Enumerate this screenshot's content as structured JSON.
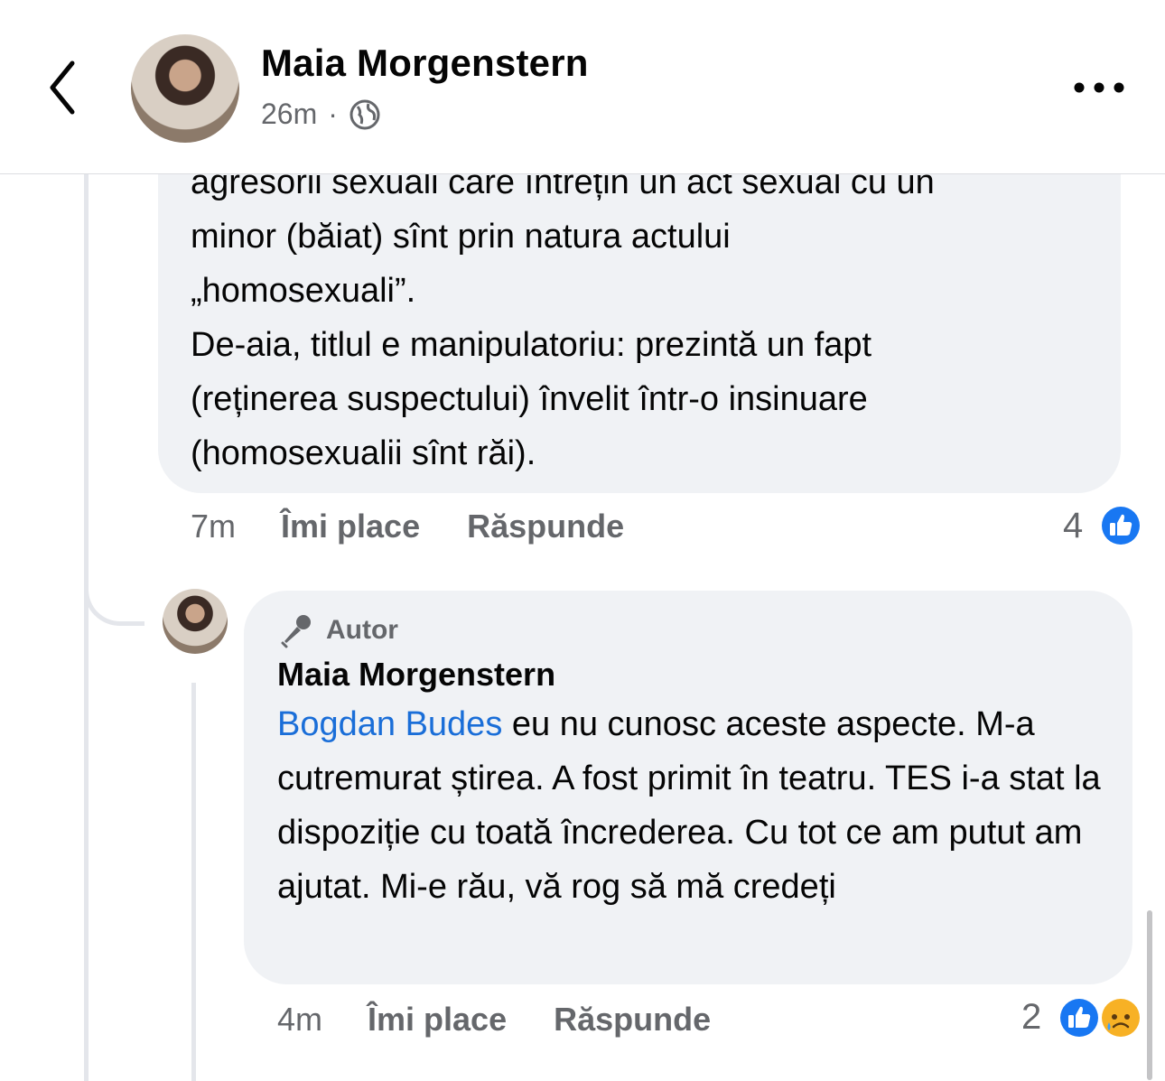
{
  "header": {
    "title": "Maia Morgenstern",
    "time": "26m",
    "separator": "·",
    "privacy_icon": "globe-icon",
    "back_icon": "chevron-left-icon",
    "more_icon": "more-icon"
  },
  "comment1": {
    "lines": "agresorii sexuali care întrețin un act sexual cu un\nminor (băiat) sînt prin natura actului\n„homosexuali”.\nDe-aia, titlul e manipulatoriu: prezintă un fapt\n(reținerea suspectului) învelit într-o insinuare\n(homosexualii sînt răi).",
    "time": "7m",
    "like_label": "Îmi place",
    "reply_label": "Răspunde",
    "reaction_count": "4",
    "reactions": [
      "like"
    ]
  },
  "reply": {
    "badge_label": "Autor",
    "badge_icon": "microphone-icon",
    "author": "Maia Morgenstern",
    "mention": "Bogdan Budes",
    "text": " eu nu cunosc aceste aspecte. M-a cutremurat știrea. A fost primit în teatru. TES i-a stat la dispoziție cu toată încrederea. Cu tot ce am putut am ajutat. Mi-e rău, vă rog să mă credeți",
    "time": "4m",
    "like_label": "Îmi place",
    "reply_label": "Răspunde",
    "reaction_count": "2",
    "reactions": [
      "like",
      "sad"
    ]
  },
  "colors": {
    "bubble": "#f0f2f5",
    "mention": "#1a6ed8",
    "like_blue": "#1877f2",
    "muted": "#65676b"
  }
}
